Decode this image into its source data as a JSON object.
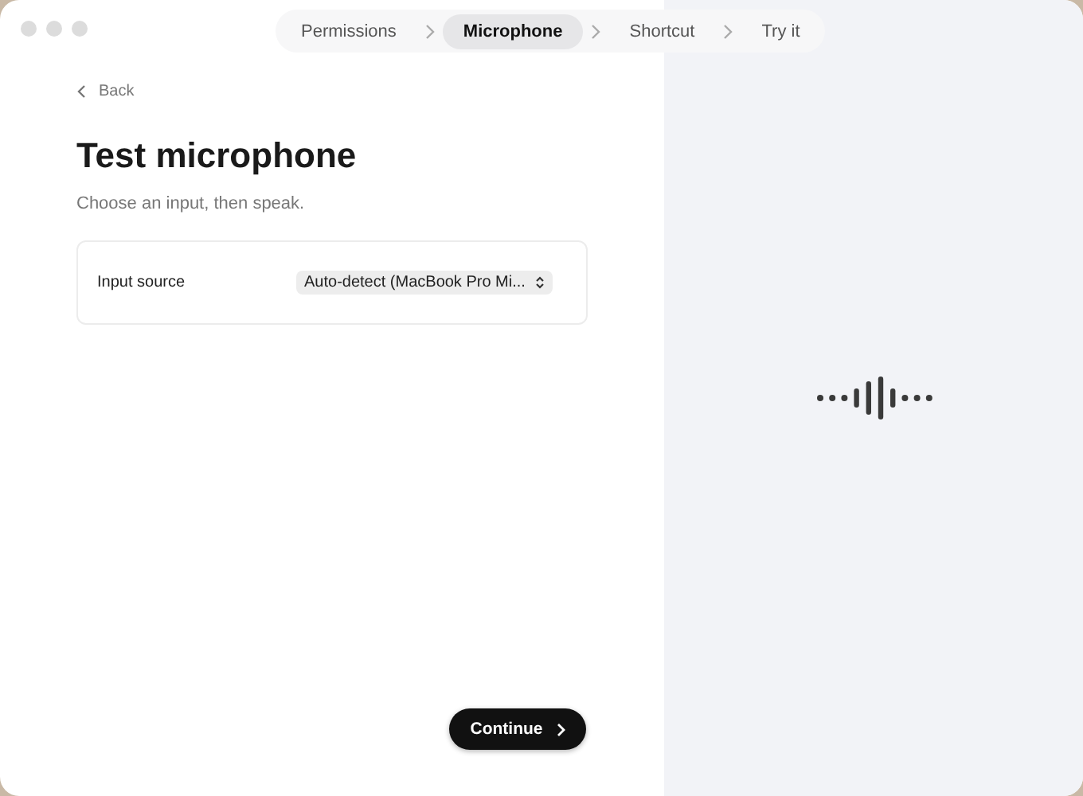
{
  "steps": [
    {
      "label": "Permissions",
      "selected": false
    },
    {
      "label": "Microphone",
      "selected": true
    },
    {
      "label": "Shortcut",
      "selected": false
    },
    {
      "label": "Try it",
      "selected": false
    }
  ],
  "back": {
    "label": "Back"
  },
  "title": "Test microphone",
  "subtitle": "Choose an input, then speak.",
  "input_source": {
    "label": "Input source",
    "value": "Auto-detect (MacBook Pro Mi..."
  },
  "continue_button": {
    "label": "Continue"
  }
}
